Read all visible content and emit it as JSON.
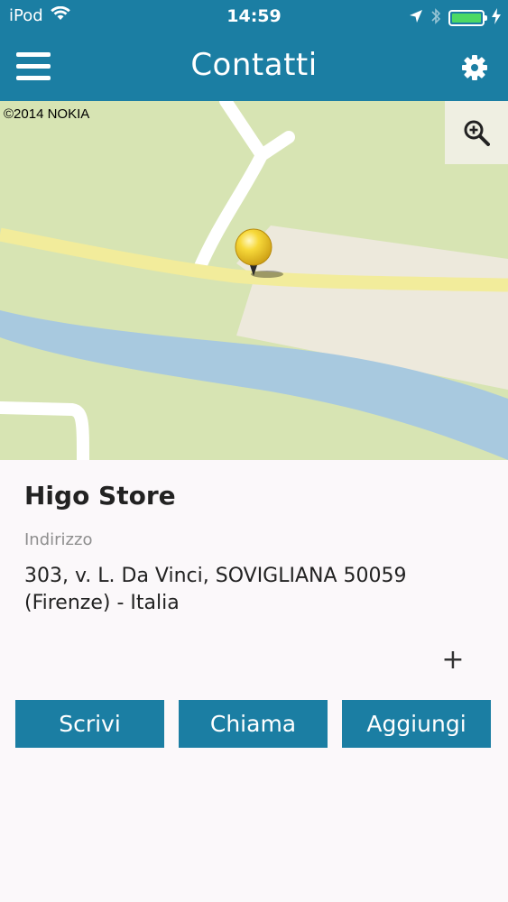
{
  "status_bar": {
    "carrier": "iPod",
    "time": "14:59",
    "battery_level": 1.0,
    "icons": [
      "wifi-icon",
      "location-arrow-icon",
      "bluetooth-icon",
      "battery-icon",
      "charging-bolt-icon"
    ]
  },
  "nav": {
    "title": "Contatti",
    "menu_icon": "hamburger-menu-icon",
    "settings_icon": "gear-icon"
  },
  "map": {
    "copyright": "©2014 NOKIA",
    "zoom_icon": "zoom-in-icon",
    "pin_icon": "map-pin-icon"
  },
  "store": {
    "name": "Higo Store",
    "address_label": "Indirizzo",
    "address": "303, v. L. Da Vinci, SOVIGLIANA 50059 (Firenze) - Italia"
  },
  "more_symbol": "+",
  "actions": {
    "write": "Scrivi",
    "call": "Chiama",
    "add": "Aggiungi"
  },
  "colors": {
    "brand": "#1b7ea3",
    "background": "#fbf8fa",
    "map_park": "#d7e4b3",
    "map_road": "#f2ec9b",
    "map_river": "#a8c9df"
  }
}
